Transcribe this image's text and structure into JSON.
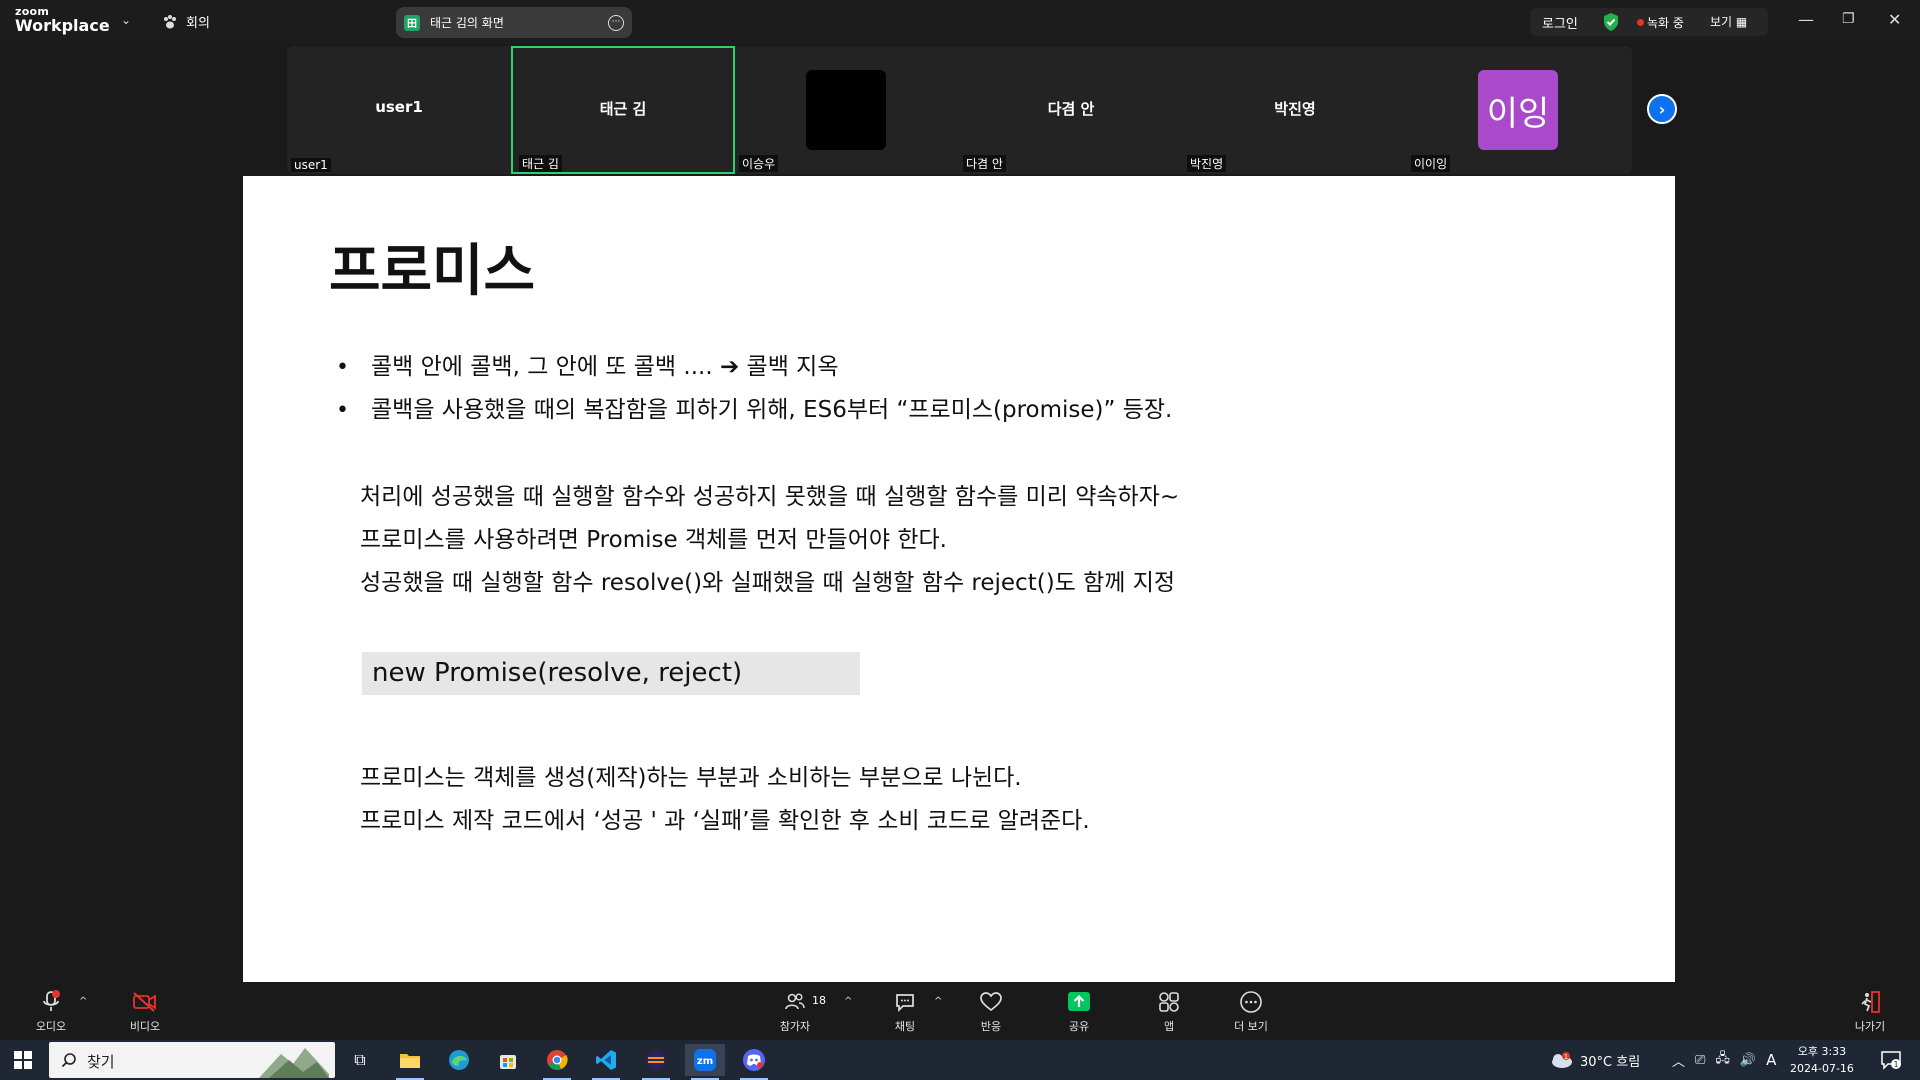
{
  "app": {
    "logo_line1": "zoom",
    "logo_line2": "Workplace",
    "meeting_label": "회의",
    "share_title": "태근 김의 화면",
    "share_app_letter": "田",
    "login": "로그인",
    "recording": "녹화 중",
    "view": "보기"
  },
  "participants": [
    {
      "center_name": "user1",
      "tag": "user1"
    },
    {
      "center_name": "태근 김",
      "tag": "태근 김",
      "active": true
    },
    {
      "center_name": "",
      "tag": "이승우"
    },
    {
      "center_name": "다겸 안",
      "tag": "다겸 안"
    },
    {
      "center_name": "박진영",
      "tag": "박진영"
    },
    {
      "center_name": "",
      "tag": "이이잉",
      "avatar_text": "이잉"
    }
  ],
  "slide": {
    "title": "프로미스",
    "bullets": [
      "콜백 안에 콜백, 그 안에 또 콜백 ....  ➔ 콜백 지옥",
      "콜백을 사용했을 때의 복잡함을 피하기 위해, ES6부터 “프로미스(promise)” 등장."
    ],
    "para1": [
      "처리에 성공했을 때 실행할 함수와 성공하지 못했을 때 실행할 함수를 미리 약속하자~",
      "프로미스를 사용하려면 Promise 객체를 먼저 만들어야 한다.",
      "성공했을 때 실행할 함수 resolve()와 실패했을 때 실행할 함수 reject()도 함께 지정"
    ],
    "code": "new Promise(resolve, reject)",
    "para2": [
      "프로미스는 객체를 생성(제작)하는 부분과 소비하는 부분으로 나뉜다.",
      "프로미스 제작 코드에서 ‘성공 ' 과 ‘실패’를 확인한 후 소비 코드로 알려준다."
    ]
  },
  "controls": {
    "audio": "오디오",
    "video": "비디오",
    "participants": "참가자",
    "participants_count": "18",
    "chat": "채팅",
    "reactions": "반응",
    "share": "공유",
    "apps": "앱",
    "more": "더 보기",
    "leave": "나가기"
  },
  "taskbar": {
    "search_placeholder": "찾기",
    "weather": "30°C  흐림",
    "weather_badge": "1",
    "ime": "A",
    "time": "오후 3:33",
    "date": "2024-07-16",
    "notif_count": "1"
  },
  "colors": {
    "zoom_blue": "#0e72ed",
    "active_green": "#2fd16b",
    "avatar_purple": "#a84ac9",
    "record_red": "#e8322e",
    "share_green": "#00c65e"
  }
}
